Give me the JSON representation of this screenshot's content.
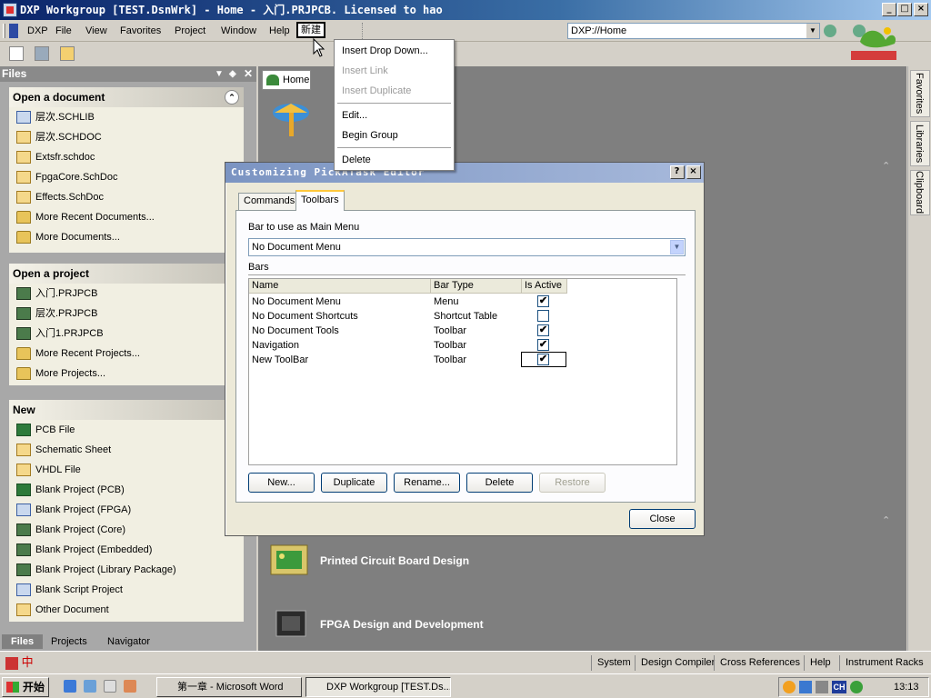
{
  "window": {
    "title": "DXP Workgroup [TEST.DsnWrk] - Home - 入门.PRJPCB. Licensed to hao",
    "minimize": "_",
    "maximize": "□",
    "close": "×"
  },
  "menubar": {
    "items": [
      "DXP",
      "File",
      "View",
      "Favorites",
      "Project",
      "Window",
      "Help",
      "新建"
    ],
    "address": "DXP://Home"
  },
  "files_panel": {
    "title": "Files",
    "open_document": {
      "title": "Open a document",
      "items": [
        "层次.SCHLIB",
        "层次.SCHDOC",
        "Extsfr.schdoc",
        "FpgaCore.SchDoc",
        "Effects.SchDoc",
        "More Recent Documents...",
        "More Documents..."
      ]
    },
    "open_project": {
      "title": "Open a project",
      "items": [
        "入门.PRJPCB",
        "层次.PRJPCB",
        "入门1.PRJPCB",
        "More Recent Projects...",
        "More Projects..."
      ]
    },
    "new": {
      "title": "New",
      "items": [
        "PCB File",
        "Schematic Sheet",
        "VHDL File",
        "Blank Project (PCB)",
        "Blank Project (FPGA)",
        "Blank Project (Core)",
        "Blank Project (Embedded)",
        "Blank Project (Library Package)",
        "Blank Script Project",
        "Other Document"
      ]
    },
    "tabs": [
      "Files",
      "Projects",
      "Navigator"
    ]
  },
  "home": {
    "tab_label": "Home",
    "sections": [
      "Printed Circuit Board Design",
      "FPGA Design and Development"
    ]
  },
  "right_dock": {
    "tabs": [
      "Favorites",
      "Libraries",
      "Clipboard"
    ]
  },
  "dropdown": {
    "items": [
      {
        "label": "Insert Drop Down...",
        "enabled": true
      },
      {
        "label": "Insert Link",
        "enabled": false
      },
      {
        "label": "Insert Duplicate",
        "enabled": false
      },
      {
        "label": "Edit...",
        "enabled": true
      },
      {
        "label": "Begin Group",
        "enabled": true
      },
      {
        "label": "Delete",
        "enabled": true
      }
    ]
  },
  "dialog": {
    "title": "Customizing PickATask Editor",
    "help": "?",
    "close_x": "×",
    "tabs": [
      "Commands",
      "Toolbars"
    ],
    "active_tab": "Toolbars",
    "main_menu_label": "Bar to use as Main Menu",
    "main_menu_value": "No Document Menu",
    "bars_label": "Bars",
    "columns": [
      "Name",
      "Bar Type",
      "Is Active"
    ],
    "rows": [
      {
        "name": "No Document Menu",
        "type": "Menu",
        "active": true
      },
      {
        "name": "No Document Shortcuts",
        "type": "Shortcut Table",
        "active": false
      },
      {
        "name": "No Document Tools",
        "type": "Toolbar",
        "active": true
      },
      {
        "name": "Navigation",
        "type": "Toolbar",
        "active": true
      },
      {
        "name": "New ToolBar",
        "type": "Toolbar",
        "active": true
      }
    ],
    "buttons": {
      "new": "New...",
      "duplicate": "Duplicate",
      "rename": "Rename...",
      "delete": "Delete",
      "restore": "Restore",
      "close": "Close"
    },
    "checkmark": "✔"
  },
  "statusbar": {
    "ime": "中",
    "items": [
      "System",
      "Design Compiler",
      "Cross References",
      "Help",
      "Instrument Racks"
    ]
  },
  "taskbar": {
    "start": "开始",
    "tasks": [
      "第一章 - Microsoft Word",
      "DXP Workgroup [TEST.Ds..."
    ],
    "clock": "13:13",
    "tray_ch": "CH"
  },
  "colors": {
    "title_active": "#0a246a",
    "dialog_title": "#7b94c2",
    "panel_bg": "#a8a8a8",
    "main_bg": "#7f7f7f"
  }
}
